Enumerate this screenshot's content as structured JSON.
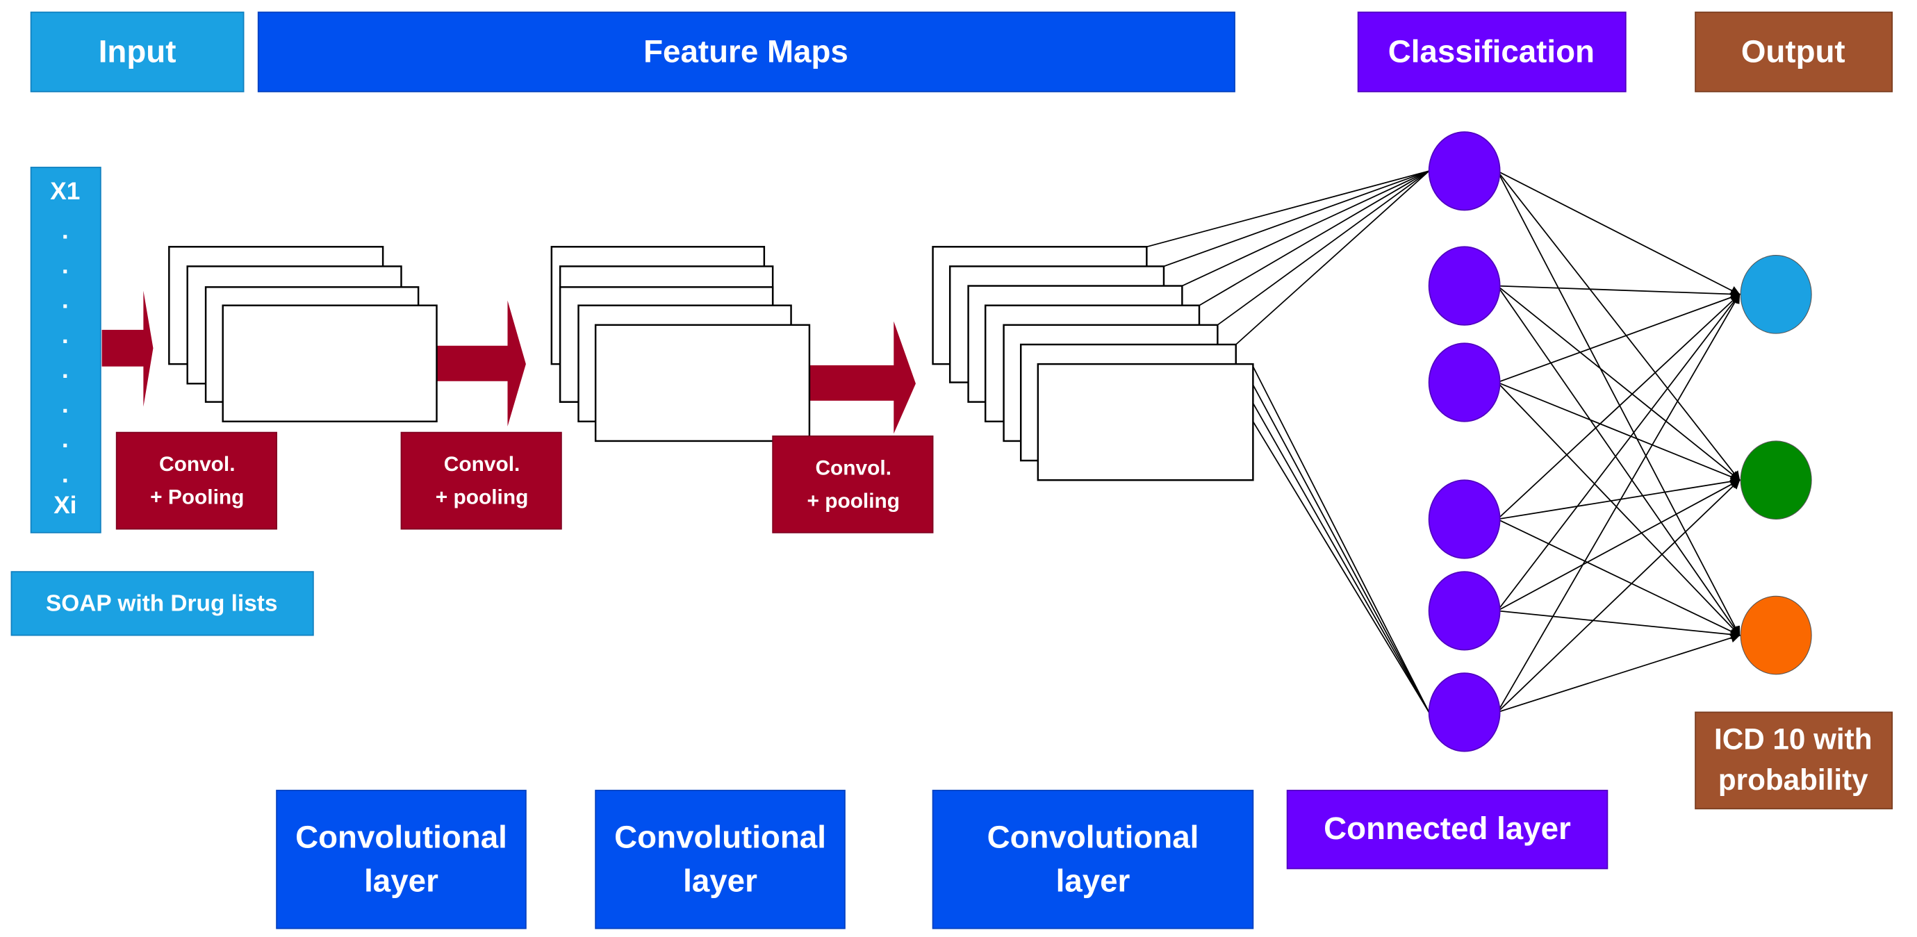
{
  "colors": {
    "input": "#1ba1e2",
    "feature": "#0050ef",
    "classification": "#6a00ff",
    "output": "#a0522d",
    "arrow": "#a20025",
    "out_nodes": [
      "#1ba1e2",
      "#008a00",
      "#fa6800"
    ]
  },
  "headers": {
    "input": "Input",
    "feature_maps": "Feature Maps",
    "classification": "Classification",
    "output": "Output"
  },
  "input_vector": {
    "first": "X1",
    "dots": [
      ".",
      ".",
      ".",
      ".",
      ".",
      ".",
      ".",
      "."
    ],
    "last": "Xi"
  },
  "input_caption": "SOAP  with Drug lists",
  "conv_steps": [
    {
      "line1": "Convol.",
      "line2": "+ Pooling"
    },
    {
      "line1": "Convol.",
      "line2": "+ pooling"
    },
    {
      "line1": "Convol.",
      "line2": "+ pooling"
    }
  ],
  "bottom_labels": [
    {
      "line1": "Convolutional",
      "line2": "layer"
    },
    {
      "line1": "Convolutional",
      "line2": "layer"
    },
    {
      "line1": "Convolutional",
      "line2": "layer"
    },
    {
      "line1": "Connected layer"
    }
  ],
  "output_caption": {
    "line1": "ICD 10 with",
    "line2": "probability"
  }
}
